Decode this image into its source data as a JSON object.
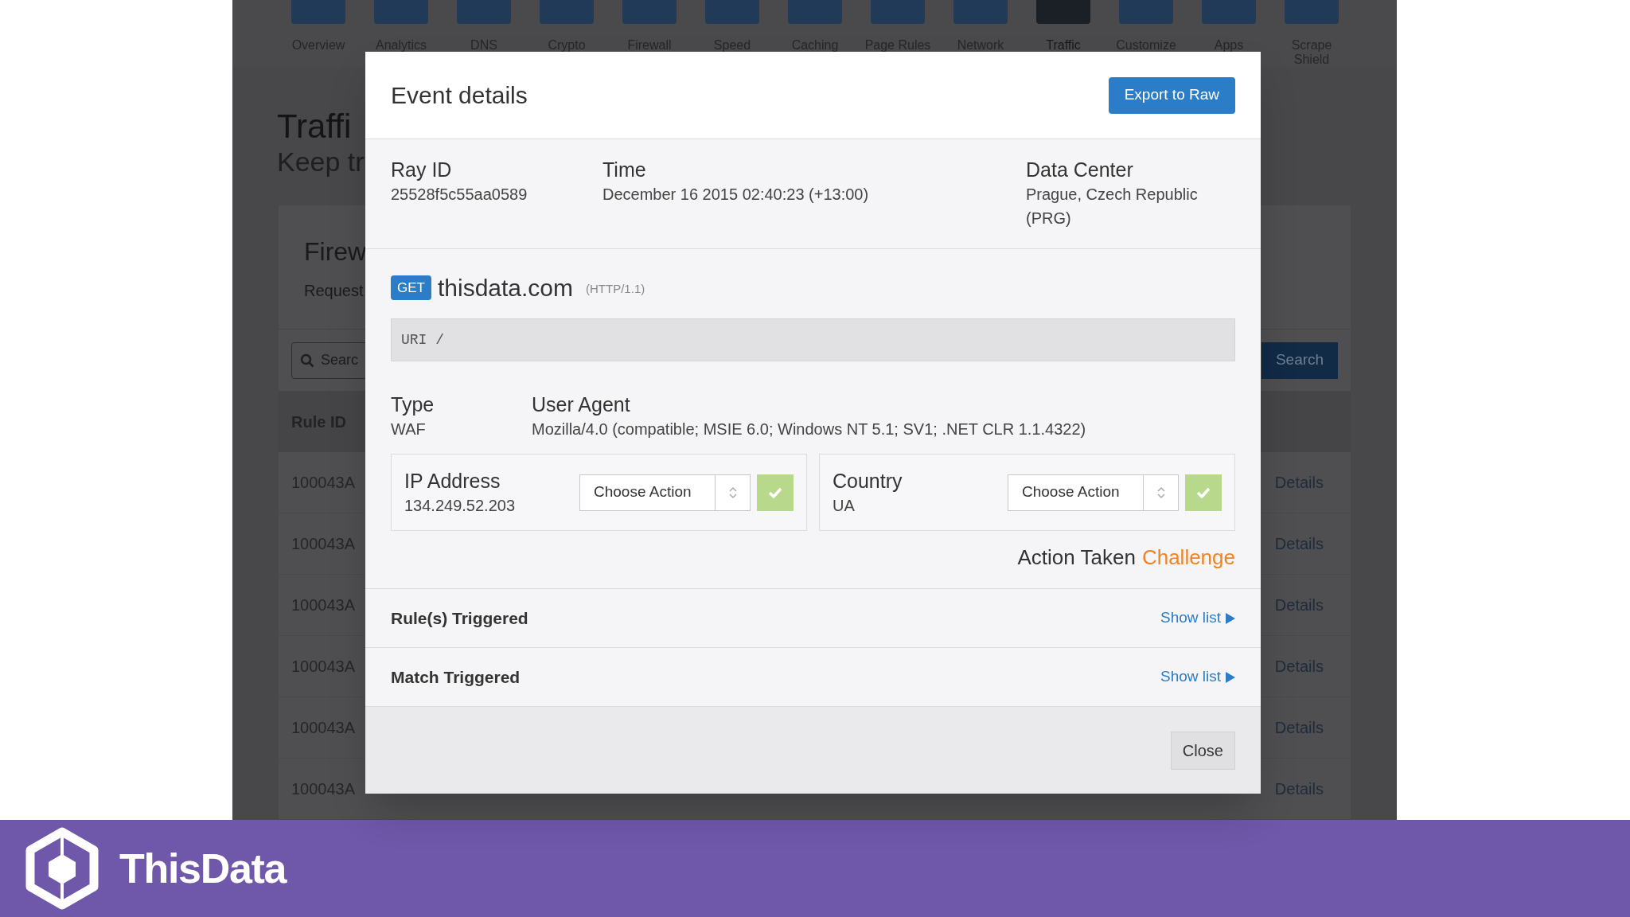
{
  "nav": [
    {
      "label": "Overview",
      "selected": false
    },
    {
      "label": "Analytics",
      "selected": false
    },
    {
      "label": "DNS",
      "selected": false
    },
    {
      "label": "Crypto",
      "selected": false
    },
    {
      "label": "Firewall",
      "selected": false
    },
    {
      "label": "Speed",
      "selected": false
    },
    {
      "label": "Caching",
      "selected": false
    },
    {
      "label": "Page Rules",
      "selected": false
    },
    {
      "label": "Network",
      "selected": false
    },
    {
      "label": "Traffic",
      "selected": true
    },
    {
      "label": "Customize",
      "selected": false
    },
    {
      "label": "Apps",
      "selected": false
    },
    {
      "label": "Scrape Shield",
      "selected": false
    }
  ],
  "page": {
    "title": "Traffi",
    "subtitle": "Keep tr"
  },
  "panel": {
    "title": "Firew",
    "subtitle": "Request",
    "search": {
      "placeholder": "Searc"
    },
    "search_button": "Search",
    "column_1": "Rule ID",
    "rows": [
      {
        "rule_id": "100043A",
        "action": "Details"
      },
      {
        "rule_id": "100043A",
        "action": "Details"
      },
      {
        "rule_id": "100043A",
        "action": "Details"
      },
      {
        "rule_id": "100043A",
        "action": "Details"
      },
      {
        "rule_id": "100043A",
        "action": "Details"
      },
      {
        "rule_id": "100043A",
        "action": "Details"
      }
    ]
  },
  "modal": {
    "title": "Event details",
    "export_button": "Export to Raw",
    "info": [
      {
        "label": "Ray ID",
        "value": "25528f5c55aa0589"
      },
      {
        "label": "Time",
        "value": "December 16 2015 02:40:23 (+13:00)"
      },
      {
        "label": "Data Center",
        "value": "Prague, Czech Republic (PRG)"
      }
    ],
    "method": "GET",
    "host": "thisdata.com",
    "protocol": "(HTTP/1.1)",
    "uri": "URI /",
    "type": {
      "label": "Type",
      "value": "WAF"
    },
    "user_agent": {
      "label": "User Agent",
      "value": "Mozilla/4.0 (compatible; MSIE 6.0; Windows NT 5.1; SV1; .NET CLR 1.1.4322)"
    },
    "targets": [
      {
        "label": "IP Address",
        "value": "134.249.52.203",
        "select": "Choose Action"
      },
      {
        "label": "Country",
        "value": "UA",
        "select": "Choose Action"
      }
    ],
    "action_taken": {
      "label": "Action Taken",
      "value": "Challenge"
    },
    "sections": [
      {
        "label": "Rule(s) Triggered",
        "link": "Show list"
      },
      {
        "label": "Match Triggered",
        "link": "Show list"
      }
    ],
    "close_button": "Close"
  },
  "banner": {
    "brand": "ThisData"
  }
}
